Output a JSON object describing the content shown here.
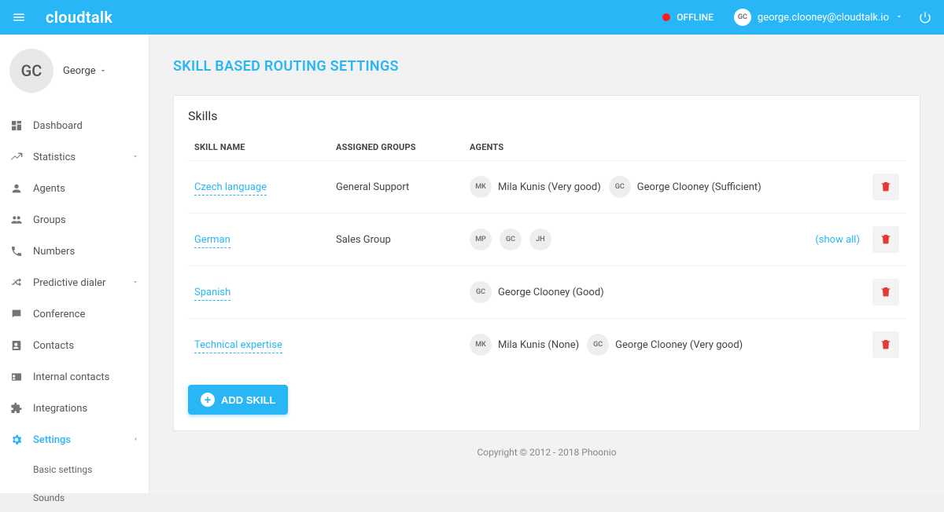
{
  "topbar": {
    "logo": "cloudtalk",
    "status_text": "OFFLINE",
    "user_initials": "GC",
    "user_email": "george.clooney@cloudtalk.io"
  },
  "sidebar": {
    "avatar_initials": "GC",
    "user_name": "George",
    "nav": [
      {
        "label": "Dashboard",
        "icon": "dashboard"
      },
      {
        "label": "Statistics",
        "icon": "trending",
        "expandable": true
      },
      {
        "label": "Agents",
        "icon": "person"
      },
      {
        "label": "Groups",
        "icon": "group"
      },
      {
        "label": "Numbers",
        "icon": "phone"
      },
      {
        "label": "Predictive dialer",
        "icon": "shuffle",
        "expandable": true
      },
      {
        "label": "Conference",
        "icon": "chat"
      },
      {
        "label": "Contacts",
        "icon": "contacts"
      },
      {
        "label": "Internal contacts",
        "icon": "cardid"
      },
      {
        "label": "Integrations",
        "icon": "puzzle"
      },
      {
        "label": "Settings",
        "icon": "gear",
        "active": true,
        "expandable": true
      }
    ],
    "subnav": [
      {
        "label": "Basic settings"
      },
      {
        "label": "Sounds"
      }
    ]
  },
  "page": {
    "title": "SKILL BASED ROUTING SETTINGS",
    "section_title": "Skills",
    "columns": {
      "skill": "SKILL NAME",
      "groups": "ASSIGNED GROUPS",
      "agents": "AGENTS"
    },
    "rows": [
      {
        "skill": "Czech language",
        "groups": "General Support",
        "agents": [
          {
            "initials": "MK",
            "label": "Mila Kunis (Very good)"
          },
          {
            "initials": "GC",
            "label": "George Clooney (Sufficient)"
          }
        ]
      },
      {
        "skill": "German",
        "groups": "Sales Group",
        "agents": [
          {
            "initials": "MP"
          },
          {
            "initials": "GC"
          },
          {
            "initials": "JH"
          }
        ],
        "show_all": "(show all)"
      },
      {
        "skill": "Spanish",
        "groups": "",
        "agents": [
          {
            "initials": "GC",
            "label": "George Clooney (Good)"
          }
        ]
      },
      {
        "skill": "Technical expertise",
        "groups": "",
        "agents": [
          {
            "initials": "MK",
            "label": "Mila Kunis (None)"
          },
          {
            "initials": "GC",
            "label": "George Clooney (Very good)"
          }
        ]
      }
    ],
    "add_button": "ADD SKILL",
    "footer": "Copyright © 2012 - 2018 Phoonio"
  }
}
